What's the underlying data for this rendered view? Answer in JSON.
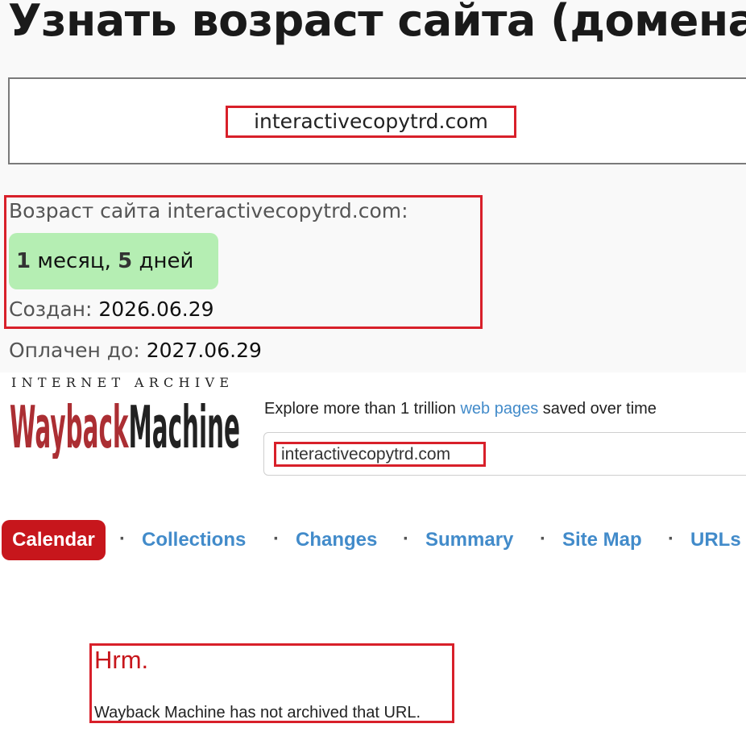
{
  "age_checker": {
    "title": "Узнать возраст сайта (домена)",
    "domain_value": "interactivecopytrd.com",
    "age_label": "Возраст сайта interactivecopytrd.com:",
    "age": {
      "months": "1",
      "months_word": "месяц,",
      "days": "5",
      "days_word": "дней"
    },
    "created": {
      "label": "Создан:",
      "value": "2026.06.29"
    },
    "paid_until": {
      "label": "Оплачен до:",
      "value": "2027.06.29"
    },
    "colors": {
      "badge": "#b5eeb3",
      "highlight": "#d8202a"
    }
  },
  "wayback": {
    "logo_top": "INTERNET ARCHIVE",
    "logo_wordmark": "WaybackMachine",
    "explore": {
      "before": "Explore more than 1 trillion ",
      "link": "web pages",
      "after": " saved over time"
    },
    "search_value": "interactivecopytrd.com",
    "nav": {
      "items": [
        "Calendar",
        "Collections",
        "Changes",
        "Summary",
        "Site Map",
        "URLs"
      ],
      "active": "Calendar",
      "separator": "·"
    },
    "error": {
      "title": "Hrm.",
      "message": "Wayback Machine has not archived that URL."
    },
    "colors": {
      "brand_red": "#c7161c",
      "link_blue": "#428bca"
    }
  }
}
